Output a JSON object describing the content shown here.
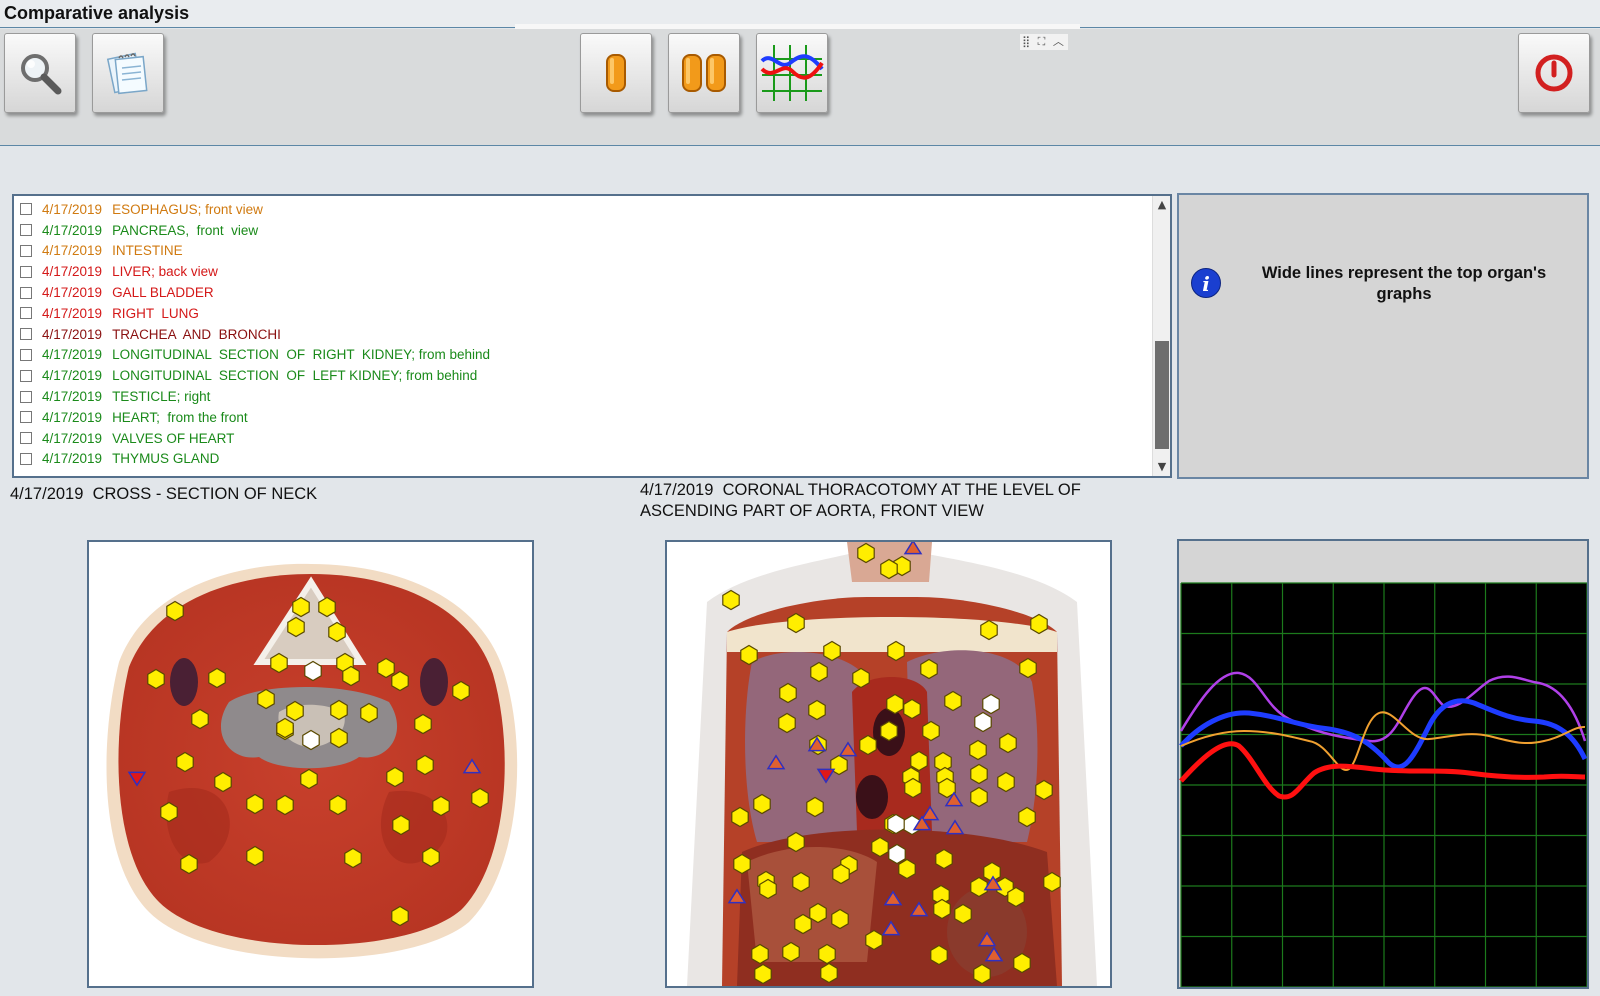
{
  "window": {
    "title": "Comparative analysis"
  },
  "toolbar": {
    "buttons": [
      {
        "name": "search-button",
        "icon": "magnifier-icon"
      },
      {
        "name": "notes-button",
        "icon": "notepad-icon"
      },
      {
        "name": "single-view-button",
        "icon": "single-capsule-icon"
      },
      {
        "name": "dual-view-button",
        "icon": "double-capsule-icon"
      },
      {
        "name": "graph-view-button",
        "icon": "line-graph-icon"
      },
      {
        "name": "power-button",
        "icon": "power-icon"
      }
    ],
    "mini_controls": "⣿ ⛶ ︿"
  },
  "records": [
    {
      "date": "4/17/2019",
      "label": "ESOPHAGUS; front view",
      "color": "#d07a10"
    },
    {
      "date": "4/17/2019",
      "label": "PANCREAS,  front  view",
      "color": "#1a8a1a"
    },
    {
      "date": "4/17/2019",
      "label": "INTESTINE",
      "color": "#d07a10"
    },
    {
      "date": "4/17/2019",
      "label": "LIVER; back view",
      "color": "#d41818"
    },
    {
      "date": "4/17/2019",
      "label": "GALL BLADDER",
      "color": "#d41818"
    },
    {
      "date": "4/17/2019",
      "label": "RIGHT  LUNG",
      "color": "#d41818"
    },
    {
      "date": "4/17/2019",
      "label": "TRACHEA  AND  BRONCHI",
      "color": "#8a1010"
    },
    {
      "date": "4/17/2019",
      "label": "LONGITUDINAL  SECTION  OF  RIGHT  KIDNEY; from behind",
      "color": "#1a8a1a"
    },
    {
      "date": "4/17/2019",
      "label": "LONGITUDINAL  SECTION  OF  LEFT KIDNEY; from behind",
      "color": "#1a8a1a"
    },
    {
      "date": "4/17/2019",
      "label": "TESTICLE; right",
      "color": "#1a8a1a"
    },
    {
      "date": "4/17/2019",
      "label": "HEART;  from the front",
      "color": "#1a8a1a"
    },
    {
      "date": "4/17/2019",
      "label": "VALVES OF HEART",
      "color": "#1a8a1a"
    },
    {
      "date": "4/17/2019",
      "label": "THYMUS GLAND",
      "color": "#1a8a1a"
    }
  ],
  "info": {
    "icon": "info-icon",
    "text": "Wide lines represent the top organ's graphs"
  },
  "captions": {
    "left": "4/17/2019  CROSS - SECTION OF NECK",
    "middle": "4/17/2019  CORONAL THORACOTOMY AT THE LEVEL OF\nASCENDING PART OF AORTA, FRONT VIEW"
  },
  "colors": {
    "accent_border": "#55708c",
    "power_red": "#d22020",
    "graph_bg": "#000000",
    "grid": "#1c7a1c",
    "series": [
      "#b040e8",
      "#1e3cff",
      "#f0a030",
      "#ff1010"
    ]
  }
}
